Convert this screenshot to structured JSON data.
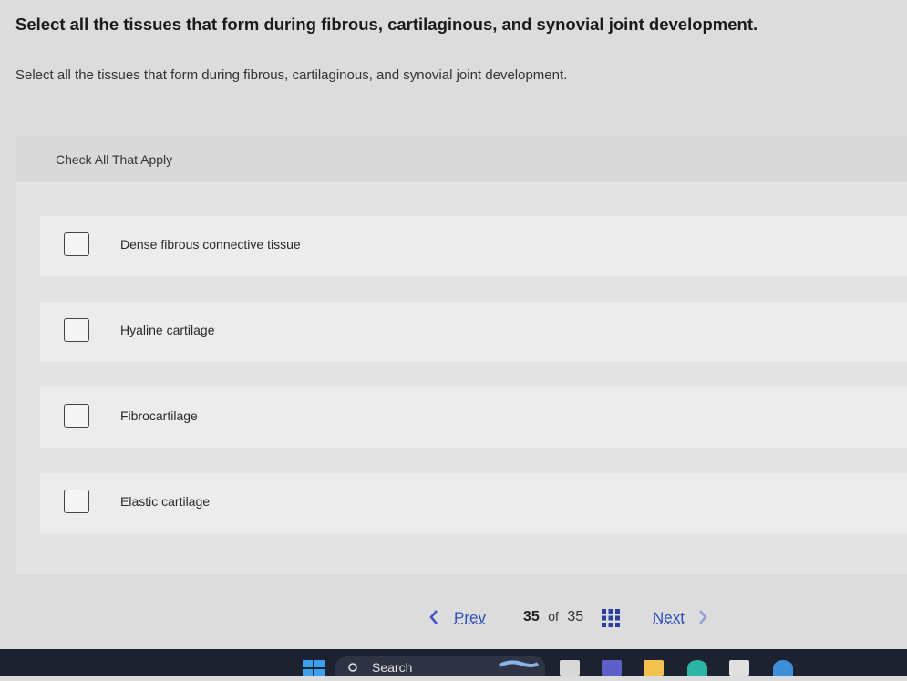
{
  "question": {
    "title": "Select all the tissues that form during fibrous, cartilaginous, and synovial joint development.",
    "subtitle": "Select all the tissues that form during fibrous, cartilaginous, and synovial joint development."
  },
  "panel": {
    "instruction": "Check All That Apply",
    "options": [
      {
        "label": "Dense fibrous connective tissue",
        "checked": false
      },
      {
        "label": "Hyaline cartilage",
        "checked": false
      },
      {
        "label": "Fibrocartilage",
        "checked": false
      },
      {
        "label": "Elastic cartilage",
        "checked": false
      }
    ]
  },
  "nav": {
    "prev_label": "Prev",
    "current_page": "35",
    "of_label": "of",
    "total_pages": "35",
    "next_label": "Next",
    "icons": [
      "chevron-left-icon",
      "grid-icon",
      "chevron-right-icon"
    ]
  },
  "taskbar": {
    "search_label": "Search",
    "icons": [
      "windows-start-icon",
      "search-icon",
      "file-explorer-icon",
      "teams-icon",
      "folder-icon",
      "edge-icon",
      "store-icon",
      "chrome-icon"
    ]
  },
  "colors": {
    "link": "#2e4fb8",
    "chevron_disabled": "#8fa0d8",
    "taskbar": "#1d2230"
  }
}
